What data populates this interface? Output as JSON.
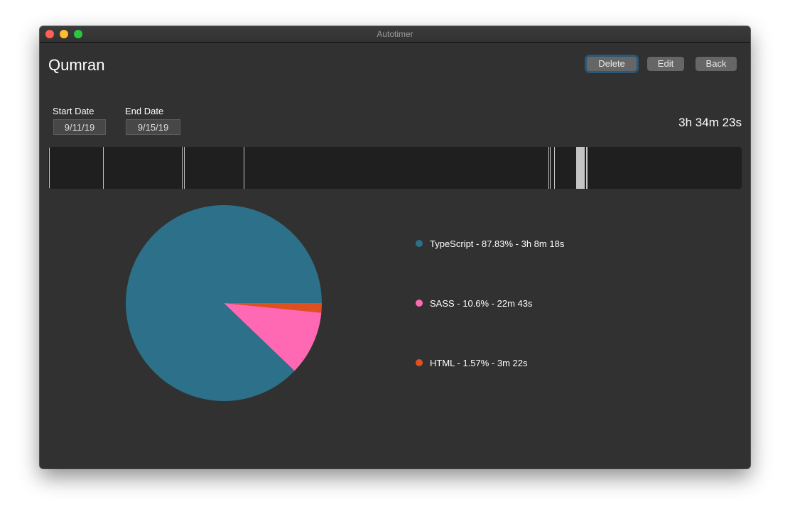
{
  "window": {
    "title": "Autotimer"
  },
  "project": {
    "name": "Qumran",
    "total": "3h 34m 23s"
  },
  "toolbar": {
    "delete_label": "Delete",
    "edit_label": "Edit",
    "back_label": "Back"
  },
  "dates": {
    "start_label": "Start Date",
    "start_value": "9/11/19",
    "end_label": "End Date",
    "end_value": "9/15/19"
  },
  "timeline": {
    "segments_percent": [
      {
        "start": 0.1,
        "width": 0.1
      },
      {
        "start": 7.85,
        "width": 0.1
      },
      {
        "start": 19.3,
        "width": 0.1
      },
      {
        "start": 19.6,
        "width": 0.1
      },
      {
        "start": 28.2,
        "width": 0.1
      },
      {
        "start": 72.1,
        "width": 0.1
      },
      {
        "start": 72.35,
        "width": 0.1
      },
      {
        "start": 72.95,
        "width": 0.15
      },
      {
        "start": 76.1,
        "width": 1.25
      },
      {
        "start": 77.55,
        "width": 0.2
      }
    ]
  },
  "chart_data": {
    "type": "pie",
    "start": "3 o'clock, clockwise",
    "slices": [
      {
        "label": "HTML - 1.57% - 3m 22s",
        "name": "HTML",
        "percent": 1.57,
        "time": "3m 22s",
        "color": "#e0501e"
      },
      {
        "label": "SASS - 10.6% - 22m 43s",
        "name": "SASS",
        "percent": 10.6,
        "time": "22m 43s",
        "color": "#ff69b4"
      },
      {
        "label": "TypeScript - 87.83% - 3h 8m 18s",
        "name": "TypeScript",
        "percent": 87.83,
        "time": "3h 8m 18s",
        "color": "#2c7189"
      }
    ],
    "legend_order": [
      2,
      1,
      0
    ],
    "legend_placement": "right"
  }
}
